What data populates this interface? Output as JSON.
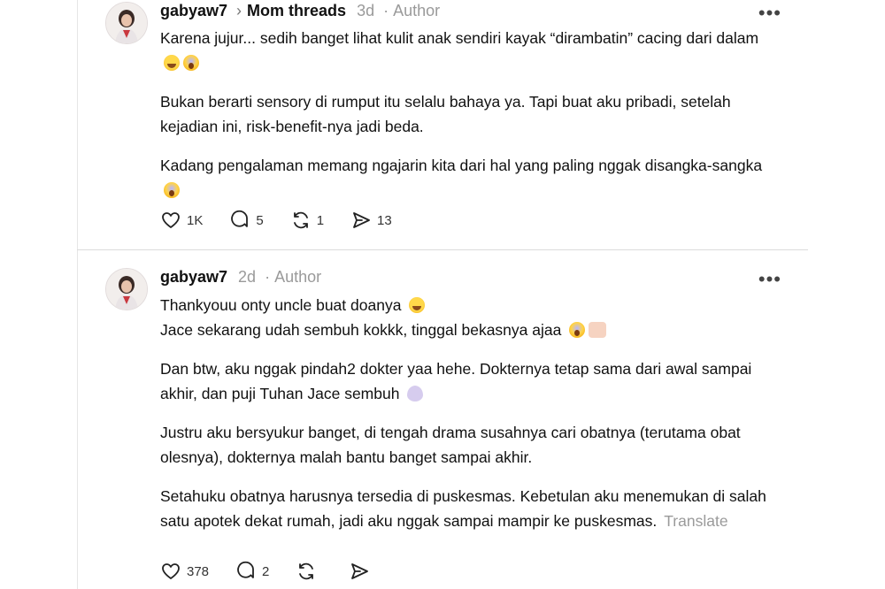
{
  "posts": [
    {
      "username": "gabyaw7",
      "community": "Mom threads",
      "time": "3d",
      "author": "Author",
      "paragraphs": [
        "Karena jujur... sedih banget lihat kulit anak sendiri kayak “dirambatin” cacing dari dalam",
        "Bukan berarti sensory di rumput itu selalu bahaya ya. Tapi buat aku pribadi, setelah kejadian ini, risk-benefit-nya jadi beda.",
        "Kadang pengalaman memang ngajarin kita dari hal yang paling nggak disangka-sangka"
      ],
      "likes": "1K",
      "replies": "5",
      "reposts": "1",
      "shares": "13"
    },
    {
      "username": "gabyaw7",
      "time": "2d",
      "author": "Author",
      "line1": "Thankyouu onty uncle buat doanya",
      "line2": "Jace sekarang udah sembuh kokkk, tinggal bekasnya ajaa",
      "paragraphs": [
        "Dan btw, aku nggak pindah2 dokter yaa hehe. Dokternya tetap sama dari awal sampai akhir, dan puji Tuhan Jace sembuh",
        "Justru aku bersyukur banget, di tengah drama susahnya cari obatnya (terutama obat olesnya), dokternya malah bantu banget sampai akhir.",
        "Setahuku obatnya harusnya tersedia di puskesmas. Kebetulan aku menemukan di salah satu apotek dekat rumah, jadi aku nggak sampai mampir ke puskesmas."
      ],
      "translate": "Translate",
      "likes": "378",
      "replies": "2"
    }
  ],
  "icons": [
    "heart-icon",
    "reply-icon",
    "repost-icon",
    "share-icon",
    "more-icon"
  ]
}
